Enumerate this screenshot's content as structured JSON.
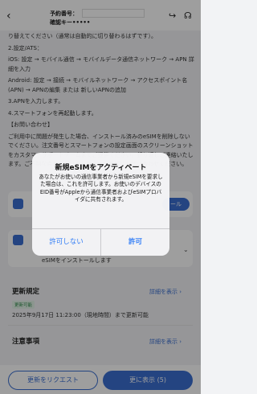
{
  "header": {
    "back_icon": "‹",
    "order_label": "予約番号：",
    "confirm_key": "確認キー•••••",
    "share_icon": "↪",
    "support_icon": "☊"
  },
  "instructions": {
    "line0": "り替えてください（通常は自動的に切り替わるはずです）。",
    "line1": "2.設定/ATS：",
    "line2": "iOS: 設定 → モバイル通信 → モバイルデータ通信ネットワーク → APN 詳細を入力",
    "line3": "Android: 設定 → 接続 → モバイルネットワーク → アクセスポイント名(APN) → APNの編集 または 新しいAPNの追加",
    "line4": "3.APNを入力します。",
    "line5": "4.スマートフォンを再起動します。",
    "line6": "【お問い合わせ】",
    "line7": "ご利用中に問題が発生した場合、インストール済みのeSIMを削除しないでください。注文番号とスマートフォンの設定画面のスクリーンショットをカスタマーサポートチームまでご提供ください。折り返しご連絡いたします。ご不明な点がございましたら、お気軽にお問い合わせください。"
  },
  "cards": {
    "card1_btn": "ール",
    "card2_text": "eSIMをインストールします"
  },
  "update": {
    "title": "更新規定",
    "detail_link": "詳細を表示 ›",
    "badge": "更新可能",
    "text": "2025年9月17日 11:23:00（現地時間）まで更新可能"
  },
  "notes": {
    "title": "注意事項",
    "detail_link": "詳細を表示 ›"
  },
  "bottom": {
    "request_update": "更新をリクエスト",
    "show_more": "更に表示 (5)"
  },
  "dialog": {
    "title": "新規eSIMをアクティベート",
    "message": "あなたがお使いの通信事業者から新規eSIMを要求した場合は、これを許可します。お使いのデバイスのEID番号がAppleから通信事業者およびeSIMプロバイダに共有されます。",
    "deny": "許可しない",
    "allow": "許可"
  },
  "colors": {
    "accent": "#3b6fd1",
    "dialog_button": "#2f7cf6"
  }
}
